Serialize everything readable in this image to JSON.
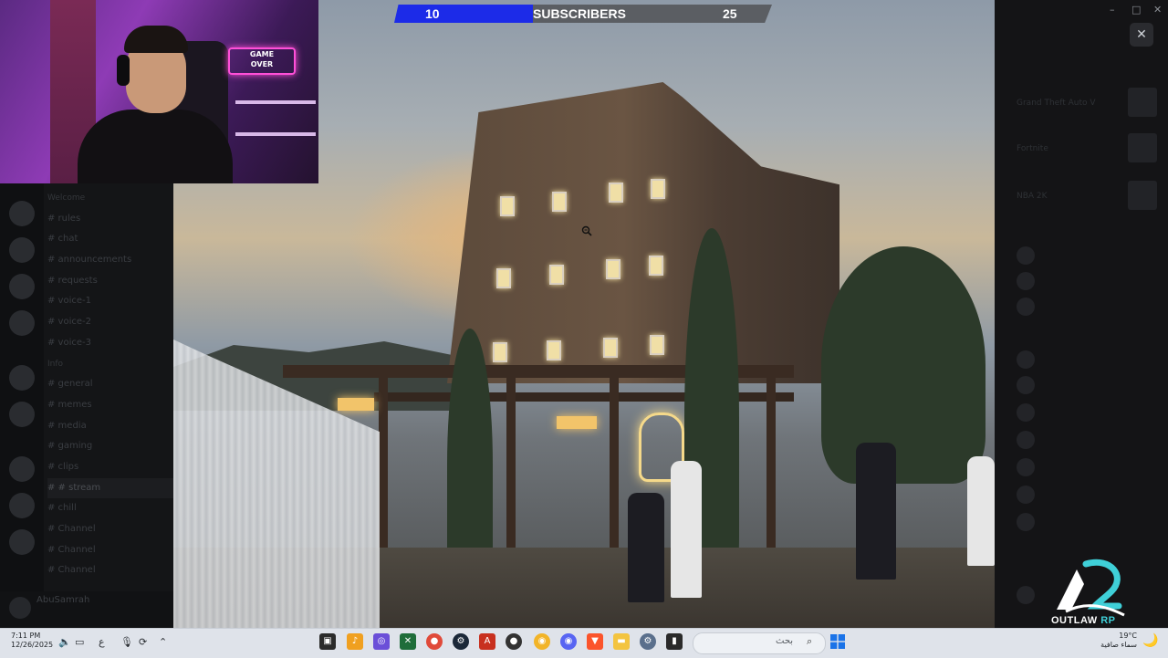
{
  "subscriber_goal": {
    "current": "10",
    "label": "SUBSCRIBERS",
    "target": "25",
    "progress": 0.4,
    "colors": {
      "fill": "#1c2be8",
      "track": "#5b5e63"
    }
  },
  "left_sidebar": {
    "categories": [
      "Welcome",
      "Info"
    ],
    "channels": [
      "# rules",
      "# chat",
      "# announcements",
      "# requests",
      "# voice-1",
      "# voice-2",
      "# voice-3",
      "# general",
      "# memes",
      "# media",
      "# gaming",
      "# clips",
      "# # stream",
      "# chill",
      "# Channel",
      "# Channel",
      "# Channel"
    ],
    "active_channel_index": 12,
    "user": {
      "name": "AbuSamrah",
      "status": ""
    }
  },
  "webcam": {
    "neon_sign_line1": "GAME",
    "neon_sign_line2": "OVER"
  },
  "right_panel": {
    "close_label": "✕",
    "window_controls": {
      "minimize": "–",
      "maximize": "□",
      "close": "✕"
    },
    "rows": [
      "",
      "Grand Theft Auto V",
      "",
      "Fortnite",
      "",
      "NBA 2K",
      "",
      "",
      "",
      "",
      "",
      ""
    ]
  },
  "branding": {
    "logo_line1": "OUTLAW",
    "logo_line2": "RP",
    "accent": "#3fd0d8"
  },
  "taskbar": {
    "time": "7:11 PM",
    "date": "12/26/2025",
    "language": "ع",
    "search_placeholder": "بحث",
    "weather_temp": "19°C",
    "weather_desc": "سماء صافية",
    "apps": [
      "call-of-duty",
      "fl-studio",
      "browser",
      "xbox",
      "chrome",
      "steam",
      "autocad",
      "app",
      "discord-alt",
      "discord",
      "brave",
      "file-explorer",
      "settings",
      "terminal"
    ]
  }
}
